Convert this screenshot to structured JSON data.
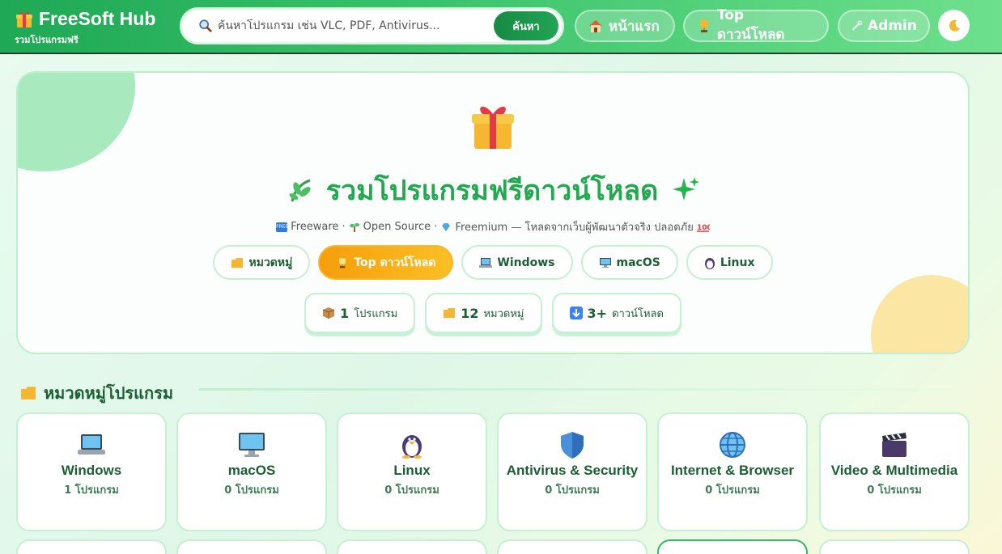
{
  "header": {
    "brand_title": "FreeSoft Hub",
    "brand_subtitle": "รวมโปรแกรมฟรี",
    "search": {
      "placeholder": "ค้นหาโปรแกรม เช่น VLC, PDF, Antivirus...",
      "button_label": "ค้นหา"
    },
    "nav": [
      {
        "label": "หน้าแรก",
        "icon": "house-icon"
      },
      {
        "label": "Top ดาวน์โหลด",
        "icon": "trophy-icon"
      },
      {
        "label": "Admin",
        "icon": "wrench-icon"
      }
    ],
    "theme_toggle_icon": "moon-icon"
  },
  "hero": {
    "title": "รวมโปรแกรมฟรีดาวน์โหลด",
    "sub": {
      "freeware": "Freeware ·",
      "opensource": "Open Source ·",
      "freemium": "Freemium — โหลดจากเว็บผู้พัฒนาตัวจริง ปลอดภัย"
    },
    "chips": [
      {
        "label": "หมวดหมู่",
        "icon": "folder-icon"
      },
      {
        "label": "Top ดาวน์โหลด",
        "icon": "trophy-icon",
        "active": true
      },
      {
        "label": "Windows",
        "icon": "laptop-icon"
      },
      {
        "label": "macOS",
        "icon": "desktop-icon"
      },
      {
        "label": "Linux",
        "icon": "penguin-icon"
      }
    ],
    "stats": [
      {
        "value": "1",
        "label": "โปรแกรม",
        "icon": "package-icon"
      },
      {
        "value": "12",
        "label": "หมวดหมู่",
        "icon": "folder-icon"
      },
      {
        "value": "3+",
        "label": "ดาวน์โหลด",
        "icon": "download-icon"
      }
    ]
  },
  "categories": {
    "heading": "หมวดหมู่โปรแกรม",
    "items": [
      {
        "name": "Windows",
        "count": "1 โปรแกรม",
        "icon": "laptop-icon"
      },
      {
        "name": "macOS",
        "count": "0 โปรแกรม",
        "icon": "desktop-icon"
      },
      {
        "name": "Linux",
        "count": "0 โปรแกรม",
        "icon": "penguin-icon"
      },
      {
        "name": "Antivirus & Security",
        "count": "0 โปรแกรม",
        "icon": "shield-icon"
      },
      {
        "name": "Internet & Browser",
        "count": "0 โปรแกรม",
        "icon": "globe-icon"
      },
      {
        "name": "Video & Multimedia",
        "count": "0 โปรแกรม",
        "icon": "clapper-icon"
      }
    ]
  },
  "colors": {
    "primary": "#22a84f",
    "accent": "#f59e0b",
    "header_start": "#1fa855"
  }
}
